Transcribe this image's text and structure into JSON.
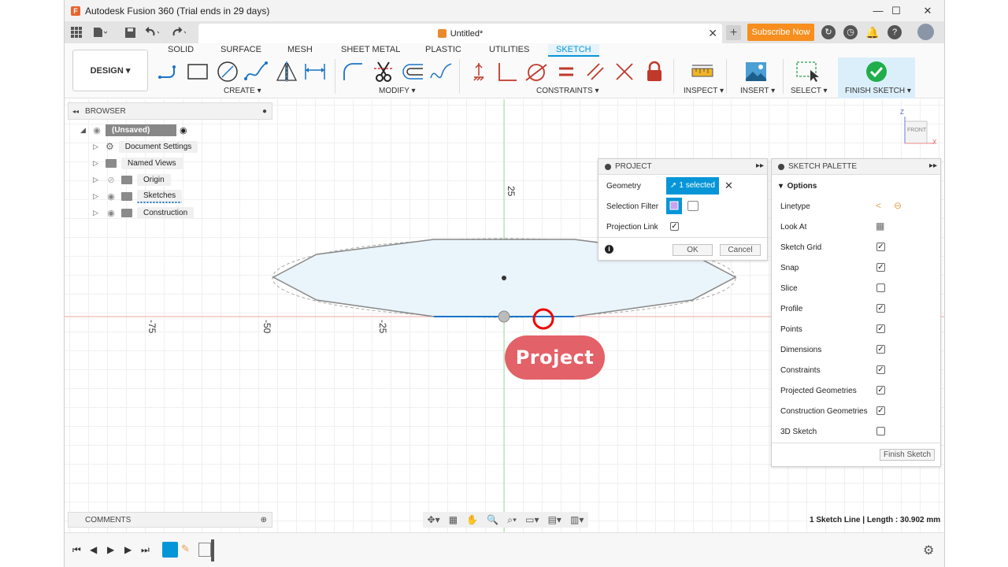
{
  "window": {
    "title": "Autodesk Fusion 360 (Trial ends in 29 days)",
    "minimize_label": "—",
    "maximize_label": "☐",
    "close_label": "✕"
  },
  "tabbar": {
    "document_tab": "Untitled*",
    "subscribe_button": "Subscribe Now"
  },
  "toolbar": {
    "workspace_button": "DESIGN",
    "workspace_tabs": [
      "SOLID",
      "SURFACE",
      "MESH",
      "SHEET METAL",
      "PLASTIC",
      "UTILITIES",
      "SKETCH"
    ],
    "active_tab": "SKETCH",
    "groups": {
      "create": "CREATE",
      "modify": "MODIFY",
      "constraints": "CONSTRAINTS",
      "inspect": "INSPECT",
      "insert": "INSERT",
      "select": "SELECT",
      "finish_sketch": "FINISH SKETCH"
    }
  },
  "browser": {
    "title": "BROWSER",
    "root": "(Unsaved)",
    "items": [
      "Document Settings",
      "Named Views",
      "Origin",
      "Sketches",
      "Construction"
    ]
  },
  "canvas": {
    "axis_labels_x": [
      "-75",
      "-50",
      "-25"
    ],
    "axis_label_y": "25",
    "view_cube_label": "FRONT",
    "view_cube_z": "Z",
    "view_cube_x": "X",
    "callout": "Project"
  },
  "project_dialog": {
    "title": "PROJECT",
    "geometry_label": "Geometry",
    "geometry_value": "1 selected",
    "selection_filter_label": "Selection Filter",
    "projection_link_label": "Projection Link",
    "projection_link_checked": true,
    "ok_button": "OK",
    "cancel_button": "Cancel"
  },
  "sketch_palette": {
    "title": "SKETCH PALETTE",
    "section": "Options",
    "options": [
      {
        "label": "Linetype",
        "type": "icons"
      },
      {
        "label": "Look At",
        "type": "icon"
      },
      {
        "label": "Sketch Grid",
        "checked": true
      },
      {
        "label": "Snap",
        "checked": true
      },
      {
        "label": "Slice",
        "checked": false
      },
      {
        "label": "Profile",
        "checked": true
      },
      {
        "label": "Points",
        "checked": true
      },
      {
        "label": "Dimensions",
        "checked": true
      },
      {
        "label": "Constraints",
        "checked": true
      },
      {
        "label": "Projected Geometries",
        "checked": true
      },
      {
        "label": "Construction Geometries",
        "checked": true
      },
      {
        "label": "3D Sketch",
        "checked": false
      }
    ],
    "finish_button": "Finish Sketch"
  },
  "comments": {
    "title": "COMMENTS"
  },
  "status_bar": {
    "text": "1 Sketch Line | Length : 30.902 mm"
  },
  "colors": {
    "accent": "#0696d7",
    "subscribe": "#f78e1e",
    "callout": "#e36168",
    "finish_check": "#1fae4b"
  }
}
